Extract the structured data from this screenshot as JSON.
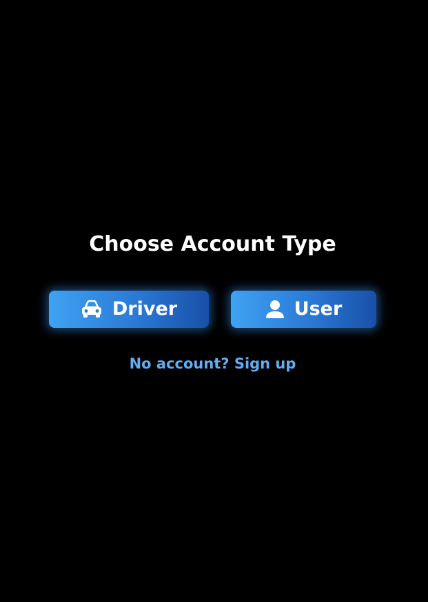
{
  "screen": {
    "title": "Choose Account Type"
  },
  "account_types": {
    "driver": {
      "label": "Driver",
      "icon": "car-icon"
    },
    "user": {
      "label": "User",
      "icon": "person-icon"
    }
  },
  "signup_link": "No account? Sign up",
  "colors": {
    "background": "#000000",
    "title": "#ffffff",
    "button_gradient_start": "#3fa2f2",
    "button_gradient_end": "#1850a8",
    "link": "#62aef2"
  }
}
